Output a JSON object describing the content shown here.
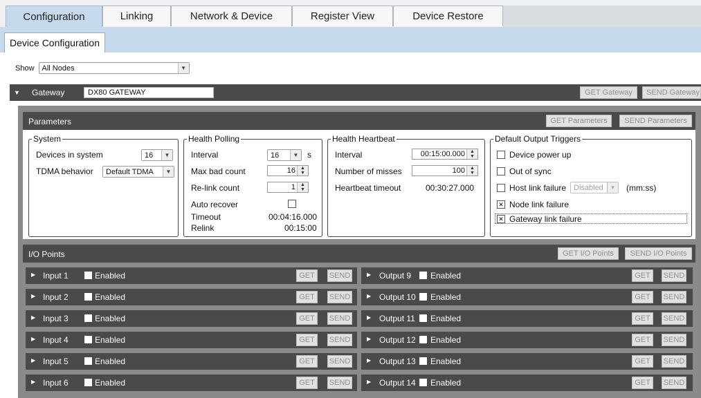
{
  "tabs": [
    "Configuration",
    "Linking",
    "Network & Device",
    "Register View",
    "Device Restore"
  ],
  "sub_tab": "Device Configuration",
  "show": {
    "label": "Show",
    "value": "All Nodes"
  },
  "gateway": {
    "label": "Gateway",
    "name": "DX80 GATEWAY",
    "get": "GET Gateway",
    "send": "SEND Gateway"
  },
  "parameters": {
    "title": "Parameters",
    "get": "GET Parameters",
    "send": "SEND Parameters",
    "system": {
      "legend": "System",
      "devices_label": "Devices in system",
      "devices_value": "16",
      "tdma_label": "TDMA behavior",
      "tdma_value": "Default TDMA"
    },
    "health_polling": {
      "legend": "Health Polling",
      "interval_label": "Interval",
      "interval_value": "16",
      "interval_unit": "s",
      "max_bad_label": "Max bad count",
      "max_bad_value": "16",
      "relink_count_label": "Re-link count",
      "relink_count_value": "1",
      "auto_recover_label": "Auto recover",
      "timeout_label": "Timeout",
      "timeout_value": "00:04:16.000",
      "relink_label": "Relink",
      "relink_value": "00:15:00"
    },
    "health_heartbeat": {
      "legend": "Health Heartbeat",
      "interval_label": "Interval",
      "interval_value": "00:15:00.000",
      "misses_label": "Number of misses",
      "misses_value": "100",
      "timeout_label": "Heartbeat timeout",
      "timeout_value": "00:30:27.000"
    },
    "triggers": {
      "legend": "Default Output Triggers",
      "device_power_up": "Device power up",
      "out_of_sync": "Out of sync",
      "host_link_failure": "Host link failure",
      "host_select": "Disabled",
      "host_unit": "(mm:ss)",
      "node_link_failure": "Node link failure",
      "gateway_link_failure": "Gateway link failure",
      "checked_mark": "✕"
    }
  },
  "io": {
    "title": "I/O Points",
    "get": "GET I/O Points",
    "send": "SEND I/O Points",
    "enabled_label": "Enabled",
    "get_btn": "GET",
    "send_btn": "SEND",
    "inputs": [
      "Input 1",
      "Input 2",
      "Input 3",
      "Input 4",
      "Input 5",
      "Input 6"
    ],
    "outputs": [
      "Output 9",
      "Output 10",
      "Output 11",
      "Output 12",
      "Output 13",
      "Output 14"
    ]
  }
}
